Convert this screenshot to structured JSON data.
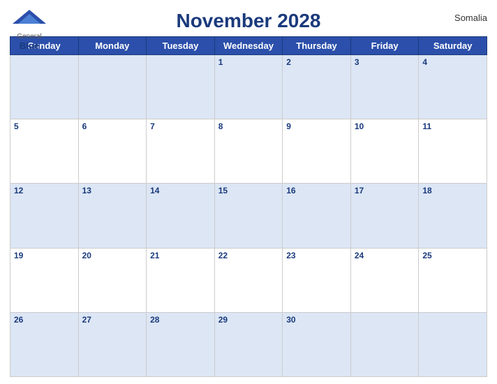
{
  "header": {
    "title": "November 2028",
    "country": "Somalia",
    "logo": {
      "general": "General",
      "blue": "Blue"
    }
  },
  "days_of_week": [
    "Sunday",
    "Monday",
    "Tuesday",
    "Wednesday",
    "Thursday",
    "Friday",
    "Saturday"
  ],
  "weeks": [
    [
      null,
      null,
      null,
      1,
      2,
      3,
      4
    ],
    [
      5,
      6,
      7,
      8,
      9,
      10,
      11
    ],
    [
      12,
      13,
      14,
      15,
      16,
      17,
      18
    ],
    [
      19,
      20,
      21,
      22,
      23,
      24,
      25
    ],
    [
      26,
      27,
      28,
      29,
      30,
      null,
      null
    ]
  ],
  "week_row_shading": [
    "shaded",
    "white",
    "shaded",
    "white",
    "shaded"
  ],
  "colors": {
    "header_bg": "#2b4faa",
    "header_text": "#ffffff",
    "title_color": "#1a3a7c",
    "day_number_color": "#1a3a7c",
    "shaded_row": "#dce6f5",
    "white_row": "#ffffff"
  }
}
